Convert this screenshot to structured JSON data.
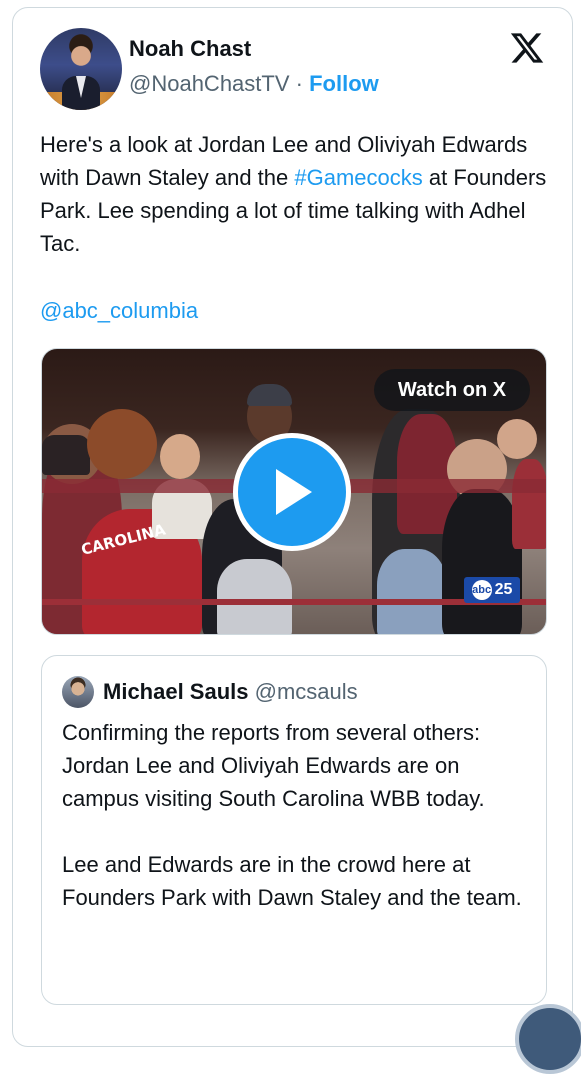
{
  "author": {
    "name": "Noah Chast",
    "handle": "@NoahChastTV",
    "separator": "·",
    "follow_label": "Follow"
  },
  "icons": {
    "brand": "x-logo-icon",
    "play": "play-icon"
  },
  "tweet": {
    "text_before_hashtag": "Here's a look at Jordan Lee and Oliviyah Edwards with Dawn Staley and the ",
    "hashtag": "#Gamecocks",
    "text_after_hashtag": " at Founders Park. Lee spending a lot of time talking with Adhel Tac.",
    "mention": "@abc_columbia"
  },
  "media": {
    "watch_label": "Watch on X",
    "shirt_text": "CAROLINA",
    "channel_logo_prefix": "abc",
    "channel_logo_number": "25"
  },
  "quoted_tweet": {
    "name": "Michael Sauls",
    "handle": "@mcsauls",
    "paragraph1": "Confirming the reports from several others: Jordan Lee and Oliviyah Edwards are on campus visiting South Carolina WBB today.",
    "paragraph2": "Lee and Edwards are in the crowd here at Founders Park with Dawn Staley and the team."
  },
  "colors": {
    "accent": "#1d9bf0",
    "text": "#0f1419",
    "secondary": "#536471",
    "border": "#cfd9de"
  }
}
